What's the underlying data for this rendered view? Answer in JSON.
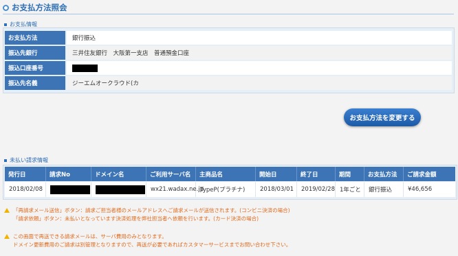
{
  "page": {
    "title": "お支払方法照会"
  },
  "payment_info": {
    "section_label": "お支払情報",
    "rows": [
      {
        "label": "お支払方法",
        "value": "銀行振込"
      },
      {
        "label": "振込先銀行",
        "value": "三井住友銀行　大阪第一支店　普通預金口座"
      },
      {
        "label": "振込口座番号",
        "value": ""
      },
      {
        "label": "振込先名義",
        "value": "ジーエムオークラウド(カ"
      }
    ]
  },
  "change_button": {
    "label": "お支払方法を変更する"
  },
  "unpaid": {
    "section_label": "未払い請求情報",
    "headers": [
      "発行日",
      "請求No",
      "ドメイン名",
      "ご利用サーバ名",
      "主商品名",
      "開始日",
      "終了日",
      "期間",
      "お支払方法",
      "ご請求金額"
    ],
    "row": {
      "issue_date": "2018/02/08",
      "invoice_no": "",
      "domain": "",
      "server": "wx21.wadax.ne.jp",
      "product": "TypeP(プラチナ)",
      "start": "2018/03/01",
      "end": "2019/02/28",
      "period": "1年ごと",
      "method": "銀行振込",
      "amount": "¥46,656"
    }
  },
  "notes": {
    "note1_line1": "「再請求メール送信」ボタン：請求ご担当者様のメールアドレスへご請求メールが送信されます。(コンビニ決済の場合)",
    "note1_line2": "「請求依頼」ボタン：未払いとなっています決済処理を弊社担当者へ依頼を行います。(カード決済の場合)",
    "note2_line1": "この画面で再送できる請求メールは、サーバ費用のみとなります。",
    "note2_line2": "ドメイン更新費用のご請求は別管理となりますので、再送が必要であればカスタマーサービスまでお問い合わせ下さい。"
  },
  "colors": {
    "accent": "#2e6fb6",
    "header_bg": "#3d74b6",
    "warning": "#e06a1c",
    "icon": "#f0b400"
  }
}
